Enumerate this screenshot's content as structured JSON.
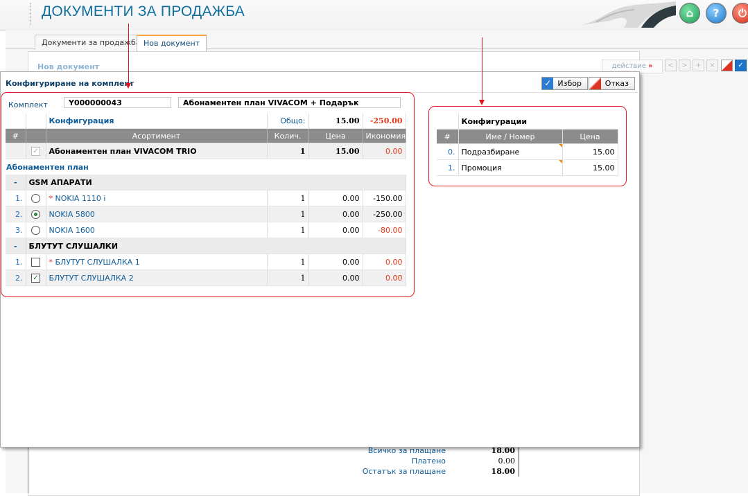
{
  "app": {
    "title": "ДОКУМЕНТИ ЗА ПРОДАЖБА"
  },
  "tabs": [
    {
      "label": "Документи за продажба"
    },
    {
      "label": "Нов документ"
    }
  ],
  "background_page": {
    "title": "Нов документ",
    "action_label": "действие",
    "action_arrow": "»",
    "totals": [
      {
        "label": "Всичко за плащане",
        "value": "18.00"
      },
      {
        "label": "Платено",
        "value": "0.00"
      },
      {
        "label": "Остатък за плащане",
        "value": "18.00"
      }
    ]
  },
  "modal": {
    "title": "Конфигуриране на комплект",
    "ok_label": "Избор",
    "cancel_label": "Отказ",
    "kit_label": "Комплект",
    "kit_code": "Y000000043",
    "kit_name": "Абонаментен план VIVACOM + Подарък",
    "summary": {
      "config_label": "Конфигурация",
      "total_label": "Общо:",
      "total_price": "15.00",
      "total_saving": "-250.00"
    },
    "columns": {
      "num": "#",
      "assortment": "Асортимент",
      "qty": "Колич.",
      "price": "Цена",
      "saving": "Икономия"
    },
    "main_item": {
      "name": "Абонаментен план VIVACOM TRIO",
      "qty": "1",
      "price": "15.00",
      "saving": "0.00"
    },
    "section_label": "Абонаментен план",
    "groups": [
      {
        "dash": "-",
        "name": "GSM АПАРАТИ",
        "items": [
          {
            "idx": "1.",
            "name": "NOKIA 1110 i",
            "star": "*",
            "qty": "1",
            "price": "0.00",
            "saving": "-150.00"
          },
          {
            "idx": "2.",
            "name": "NOKIA 5800",
            "star": "",
            "qty": "1",
            "price": "0.00",
            "saving": "-250.00"
          },
          {
            "idx": "3.",
            "name": "NOKIA 1600",
            "star": "",
            "qty": "1",
            "price": "0.00",
            "saving": "-80.00"
          }
        ]
      },
      {
        "dash": "-",
        "name": "БЛУТУТ СЛУШАЛКИ",
        "items": [
          {
            "idx": "1.",
            "name": "БЛУТУТ СЛУШАЛКА 1",
            "star": "*",
            "qty": "1",
            "price": "0.00",
            "saving": "0.00"
          },
          {
            "idx": "2.",
            "name": "БЛУТУТ СЛУШАЛКА 2",
            "star": "",
            "qty": "1",
            "price": "0.00",
            "saving": "0.00"
          }
        ]
      }
    ]
  },
  "configurations": {
    "title": "Конфигурации",
    "columns": {
      "num": "#",
      "name": "Име / Номер",
      "price": "Цена"
    },
    "rows": [
      {
        "idx": "0.",
        "name": "Подразбиране",
        "price": "15.00"
      },
      {
        "idx": "1.",
        "name": "Промоция",
        "price": "15.00"
      }
    ]
  },
  "colors": {
    "accent_blue": "#0e6ea0",
    "annotation_red": "#e21b25",
    "negative_red": "#e23a1b",
    "header_gray": "#8c8c8c"
  },
  "icons": {
    "home": "home-icon",
    "help": "help-icon",
    "power": "power-icon",
    "ok": "check-icon",
    "cancel": "cancel-icon"
  }
}
